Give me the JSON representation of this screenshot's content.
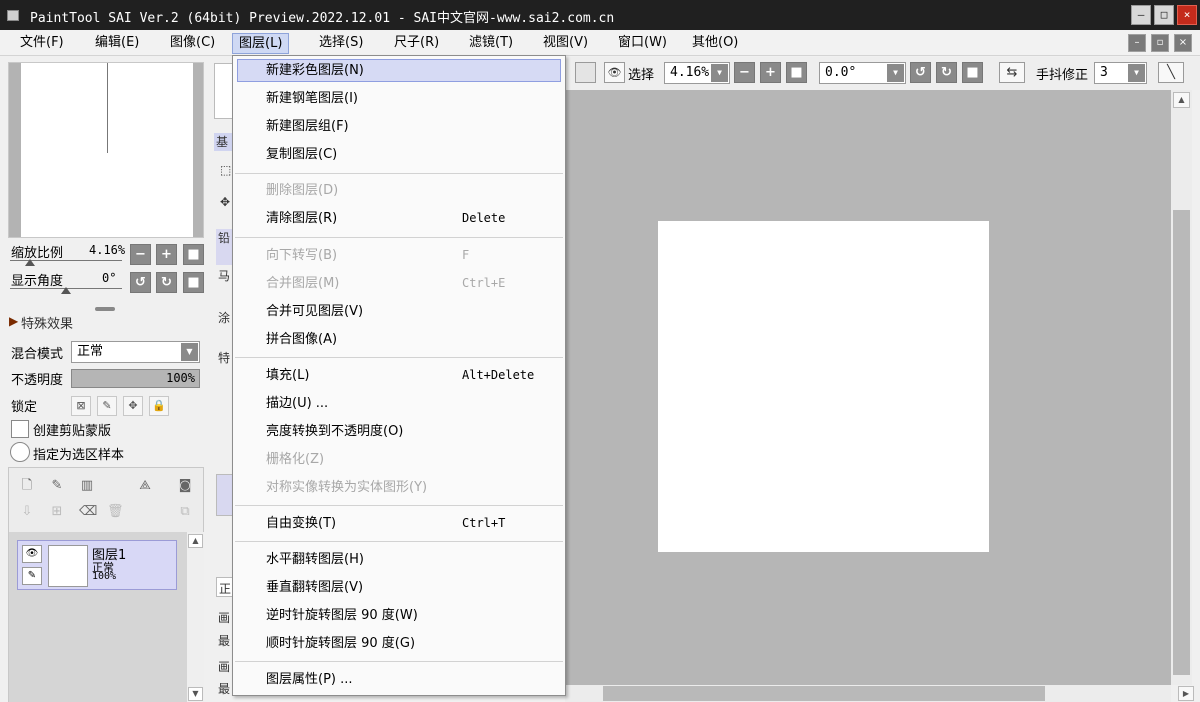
{
  "titlebar": {
    "title": "PaintTool SAI Ver.2 (64bit) Preview.2022.12.01 - SAI中文官网-www.sai2.com.cn"
  },
  "window_controls": {
    "minimize": "–",
    "maximize": "□",
    "close": "×"
  },
  "menubar": {
    "items": [
      {
        "label": "文件(F)"
      },
      {
        "label": "编辑(E)"
      },
      {
        "label": "图像(C)"
      },
      {
        "label": "图层(L)"
      },
      {
        "label": "选择(S)"
      },
      {
        "label": "尺子(R)"
      },
      {
        "label": "滤镜(T)"
      },
      {
        "label": "视图(V)"
      },
      {
        "label": "窗口(W)"
      },
      {
        "label": "其他(O)"
      }
    ],
    "active_index": 3
  },
  "toolbar": {
    "select_label": "选择",
    "zoom_value": "4.16%",
    "angle_value": "0.0°",
    "stabilizer_label": "手抖修正",
    "stabilizer_value": "3"
  },
  "navigator": {
    "zoom_label": "缩放比例",
    "zoom_value": "4.16%",
    "angle_label": "显示角度",
    "angle_value": "0°"
  },
  "effects": {
    "label": "特殊效果"
  },
  "layer_props": {
    "blend_label": "混合模式",
    "blend_value": "正常",
    "opacity_label": "不透明度",
    "opacity_value": "100%",
    "lock_label": "锁定",
    "clip_label": "创建剪贴蒙版",
    "sample_label": "指定为选区样本"
  },
  "layers": [
    {
      "name": "图层1",
      "mode": "正常",
      "opacity": "100%"
    }
  ],
  "tool_panel_partial": {
    "tab": "基",
    "t1": "铅",
    "t2": "马",
    "t3": "涂",
    "t4": "特",
    "mode": "正",
    "r1": "画",
    "r2": "最",
    "r3": "画",
    "r4": "最"
  },
  "layer_menu": {
    "items": [
      {
        "label": "新建彩色图层(N)",
        "shortcut": "",
        "disabled": false,
        "highlighted": true
      },
      {
        "label": "新建钢笔图层(I)",
        "shortcut": "",
        "disabled": false
      },
      {
        "label": "新建图层组(F)",
        "shortcut": "",
        "disabled": false
      },
      {
        "label": "复制图层(C)",
        "shortcut": "",
        "disabled": false
      },
      {
        "label": "删除图层(D)",
        "shortcut": "",
        "disabled": true
      },
      {
        "label": "清除图层(R)",
        "shortcut": "Delete",
        "disabled": false
      },
      {
        "label": "向下转写(B)",
        "shortcut": "F",
        "disabled": true
      },
      {
        "label": "合并图层(M)",
        "shortcut": "Ctrl+E",
        "disabled": true
      },
      {
        "label": "合并可见图层(V)",
        "shortcut": "",
        "disabled": false
      },
      {
        "label": "拼合图像(A)",
        "shortcut": "",
        "disabled": false
      },
      {
        "label": "填充(L)",
        "shortcut": "Alt+Delete",
        "disabled": false
      },
      {
        "label": "描边(U) ...",
        "shortcut": "",
        "disabled": false
      },
      {
        "label": "亮度转换到不透明度(O)",
        "shortcut": "",
        "disabled": false
      },
      {
        "label": "栅格化(Z)",
        "shortcut": "",
        "disabled": true
      },
      {
        "label": "对称实像转换为实体图形(Y)",
        "shortcut": "",
        "disabled": true
      },
      {
        "label": "自由变换(T)",
        "shortcut": "Ctrl+T",
        "disabled": false
      },
      {
        "label": "水平翻转图层(H)",
        "shortcut": "",
        "disabled": false
      },
      {
        "label": "垂直翻转图层(V)",
        "shortcut": "",
        "disabled": false
      },
      {
        "label": "逆时针旋转图层 90 度(W)",
        "shortcut": "",
        "disabled": false
      },
      {
        "label": "顺时针旋转图层 90 度(G)",
        "shortcut": "",
        "disabled": false
      },
      {
        "label": "图层属性(P) ...",
        "shortcut": "",
        "disabled": false
      }
    ]
  },
  "colors": {
    "highlight": "#d6daf4",
    "canvas_bg": "#b6b6b6",
    "titlebar": "#202020"
  }
}
